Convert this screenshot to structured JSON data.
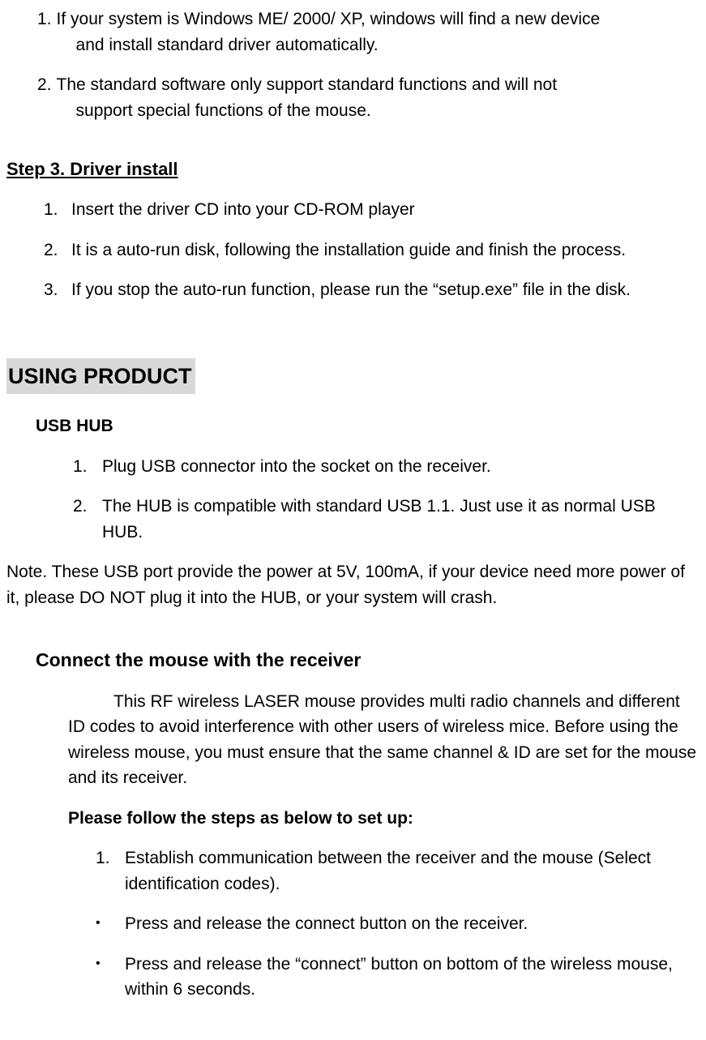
{
  "top_notes": [
    {
      "num": "1.",
      "first": "If your system is Windows ME/ 2000/ XP, windows will find a new device",
      "cont": "and install standard driver automatically."
    },
    {
      "num": "2.",
      "first": "The standard software only support standard functions and will not",
      "cont": "support special functions of the mouse."
    }
  ],
  "step3": {
    "heading": "Step 3. Driver install",
    "items": [
      {
        "num": "1.",
        "text": "Insert the driver CD into your CD-ROM player"
      },
      {
        "num": "2.",
        "text": "It is a auto-run disk, following the installation guide and finish the process."
      },
      {
        "num": "3.",
        "text": "If you stop the auto-run function, please run the “setup.exe” file in the disk."
      }
    ]
  },
  "using": {
    "heading": "USING PRODUCT",
    "usb_hub": {
      "title": "USB HUB",
      "items": [
        {
          "num": "1.",
          "text": "Plug USB connector into the socket on the receiver."
        },
        {
          "num": "2.",
          "text": "The HUB is compatible with standard USB 1.1. Just use it as normal USB HUB."
        }
      ],
      "note": "Note. These USB port provide the power at 5V, 100mA, if your device need more power of it, please DO NOT plug it into the HUB, or your system will crash."
    },
    "connect": {
      "heading": "Connect the mouse with the receiver",
      "para": "This RF wireless LASER mouse provides multi radio channels and different ID codes to avoid interference with other users of wireless mice. Before using the wireless mouse, you must ensure that the same channel & ID are set for the mouse and its receiver.",
      "instruction": "Please follow the steps as below to set up:",
      "items": [
        {
          "marker": "1.",
          "text": "Establish communication between the receiver and the mouse (Select identification codes)."
        },
        {
          "marker": "bullet",
          "text": "Press and release the connect button on the receiver."
        },
        {
          "marker": "bullet",
          "text": "Press and release the “connect” button on bottom of the wireless mouse, within 6 seconds."
        }
      ]
    }
  }
}
